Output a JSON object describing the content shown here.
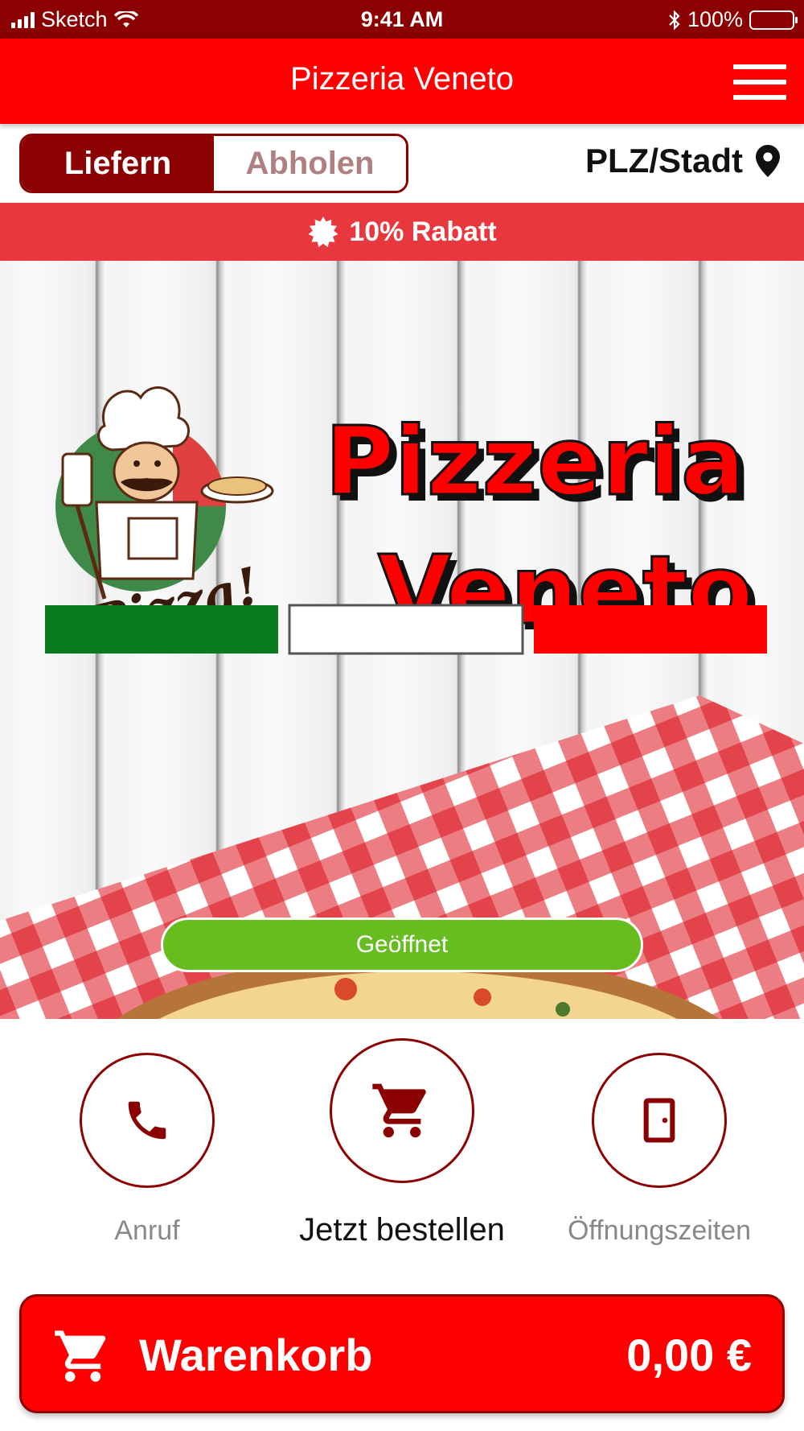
{
  "status_bar": {
    "carrier": "Sketch",
    "time": "9:41 AM",
    "battery": "100%"
  },
  "header": {
    "title": "Pizzeria Veneto"
  },
  "order_mode": {
    "options": [
      {
        "label": "Liefern",
        "selected": true
      },
      {
        "label": "Abholen",
        "selected": false
      }
    ],
    "location_label": "PLZ/Stadt"
  },
  "discount_banner": {
    "text": "10% Rabatt"
  },
  "hero": {
    "logo_line1": "Pizzeria",
    "logo_line2": "Veneto",
    "chef_caption": "Pizza!",
    "status": "Geöffnet"
  },
  "actions": [
    {
      "label": "Anruf",
      "icon": "phone-icon"
    },
    {
      "label": "Jetzt bestellen",
      "icon": "cart-icon"
    },
    {
      "label": "Öffnungszeiten",
      "icon": "door-icon"
    }
  ],
  "cart": {
    "label": "Warenkorb",
    "total": "0,00 €"
  },
  "colors": {
    "brand_red": "#ff0000",
    "dark_red": "#8b0000",
    "banner_red": "#e8383d",
    "open_green": "#67bc1f",
    "flag_green": "#0a7a1e"
  }
}
